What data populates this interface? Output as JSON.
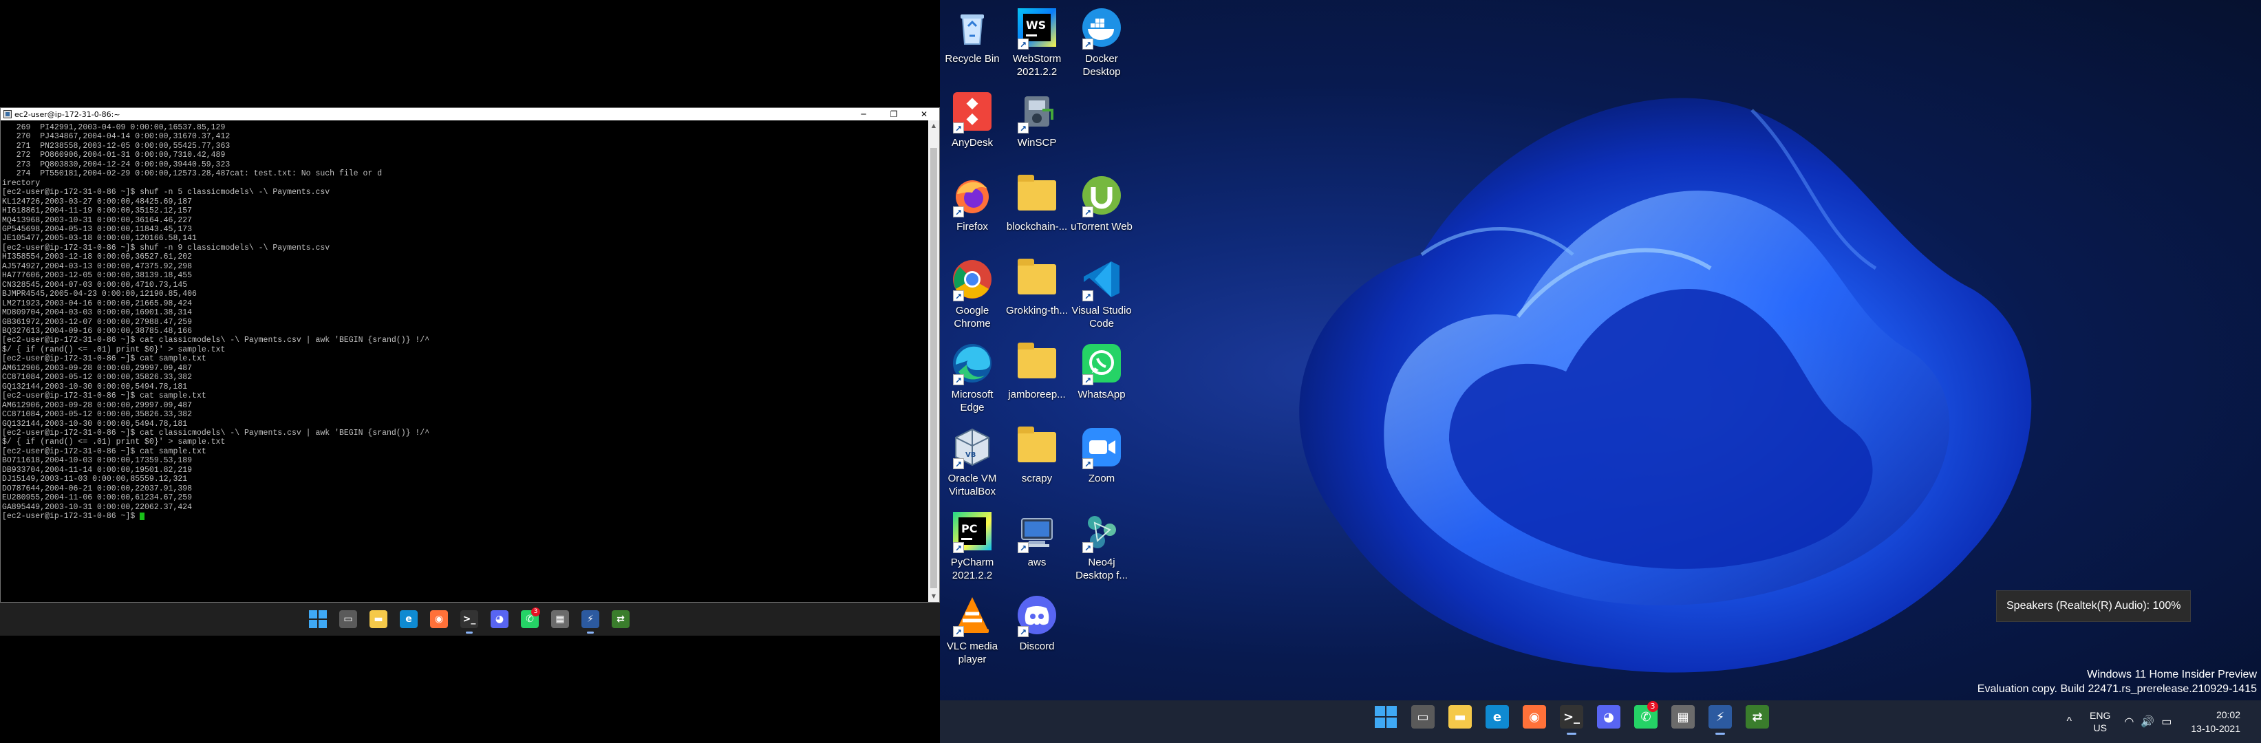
{
  "terminal": {
    "title": "ec2-user@ip-172-31-0-86:~",
    "controls": [
      "─",
      "❐",
      "✕"
    ],
    "lines": [
      "   269  PI42991,2003-04-09 0:00:00,16537.85,129",
      "   270  PJ434867,2004-04-14 0:00:00,31670.37,412",
      "   271  PN238558,2003-12-05 0:00:00,55425.77,363",
      "   272  PO860906,2004-01-31 0:00:00,7310.42,489",
      "   273  PQ803830,2004-12-24 0:00:00,39440.59,323",
      "   274  PT550181,2004-02-29 0:00:00,12573.28,487cat: test.txt: No such file or d",
      "irectory",
      "[ec2-user@ip-172-31-0-86 ~]$ shuf -n 5 classicmodels\\ -\\ Payments.csv",
      "KL124726,2003-03-27 0:00:00,48425.69,187",
      "HI618861,2004-11-19 0:00:00,35152.12,157",
      "MQ413968,2003-10-31 0:00:00,36164.46,227",
      "GP545698,2004-05-13 0:00:00,11843.45,173",
      "JE105477,2005-03-18 0:00:00,120166.58,141",
      "[ec2-user@ip-172-31-0-86 ~]$ shuf -n 9 classicmodels\\ -\\ Payments.csv",
      "HI358554,2003-12-18 0:00:00,36527.61,202",
      "AJ574927,2004-03-13 0:00:00,47375.92,298",
      "HA777606,2003-12-05 0:00:00,38139.18,455",
      "CN328545,2004-07-03 0:00:00,4710.73,145",
      "BJMPR4545,2005-04-23 0:00:00,12190.85,406",
      "LM271923,2003-04-16 0:00:00,21665.98,424",
      "MD809704,2004-03-03 0:00:00,16901.38,314",
      "GB361972,2003-12-07 0:00:00,27988.47,259",
      "BQ327613,2004-09-16 0:00:00,38785.48,166",
      "[ec2-user@ip-172-31-0-86 ~]$ cat classicmodels\\ -\\ Payments.csv | awk 'BEGIN {srand()} !/^",
      "$/ { if (rand() <= .01) print $0}' > sample.txt",
      "[ec2-user@ip-172-31-0-86 ~]$ cat sample.txt",
      "AM612906,2003-09-28 0:00:00,29997.09,487",
      "CC871084,2003-05-12 0:00:00,35826.33,382",
      "GQ132144,2003-10-30 0:00:00,5494.78,181",
      "[ec2-user@ip-172-31-0-86 ~]$ cat sample.txt",
      "AM612906,2003-09-28 0:00:00,29997.09,487",
      "CC871084,2003-05-12 0:00:00,35826.33,382",
      "GQ132144,2003-10-30 0:00:00,5494.78,181",
      "[ec2-user@ip-172-31-0-86 ~]$ cat classicmodels\\ -\\ Payments.csv | awk 'BEGIN {srand()} !/^",
      "$/ { if (rand() <= .01) print $0}' > sample.txt",
      "[ec2-user@ip-172-31-0-86 ~]$ cat sample.txt",
      "BO711618,2004-10-03 0:00:00,17359.53,189",
      "DB933704,2004-11-14 0:00:00,19501.82,219",
      "DJ15149,2003-11-03 0:00:00,85559.12,321",
      "DO787644,2004-06-21 0:00:00,22037.91,398",
      "EU280955,2004-11-06 0:00:00,61234.67,259",
      "GA895449,2003-10-31 0:00:00,22062.37,424"
    ],
    "prompt": "[ec2-user@ip-172-31-0-86 ~]$ "
  },
  "left_taskbar": {
    "icons": [
      {
        "name": "start-icon",
        "glyph": "",
        "color": "#3fa9f5",
        "active": false
      },
      {
        "name": "task-view-icon",
        "glyph": "▭",
        "color": "#5a5a5a",
        "active": false
      },
      {
        "name": "file-explorer-icon",
        "glyph": "▬",
        "color": "#f5c94a",
        "active": false
      },
      {
        "name": "edge-icon",
        "glyph": "e",
        "color": "#0f8ad1",
        "active": false
      },
      {
        "name": "firefox-icon",
        "glyph": "◉",
        "color": "#ff7139",
        "active": false
      },
      {
        "name": "terminal-icon",
        "glyph": ">_",
        "color": "#333333",
        "active": true
      },
      {
        "name": "discord-icon",
        "glyph": "◕",
        "color": "#5865f2",
        "active": false
      },
      {
        "name": "whatsapp-icon",
        "glyph": "✆",
        "color": "#25d366",
        "active": false,
        "badge": "3"
      },
      {
        "name": "calculator-icon",
        "glyph": "▦",
        "color": "#6b6b6b",
        "active": false
      },
      {
        "name": "putty-icon",
        "glyph": "⚡",
        "color": "#2c5aa0",
        "active": true
      },
      {
        "name": "winscp-icon",
        "glyph": "⇄",
        "color": "#3a7d2c",
        "active": false
      }
    ]
  },
  "desktop": {
    "icons": [
      {
        "name": "recycle-bin",
        "label": "Recycle Bin",
        "art": "recycle",
        "col": 0,
        "row": 0
      },
      {
        "name": "webstorm",
        "label": "WebStorm 2021.2.2",
        "art": "ws",
        "col": 1,
        "row": 0
      },
      {
        "name": "docker-desktop",
        "label": "Docker Desktop",
        "art": "docker",
        "col": 2,
        "row": 0
      },
      {
        "name": "anydesk",
        "label": "AnyDesk",
        "art": "anydesk",
        "col": 0,
        "row": 1
      },
      {
        "name": "winscp",
        "label": "WinSCP",
        "art": "winscp",
        "col": 1,
        "row": 1
      },
      {
        "name": "firefox",
        "label": "Firefox",
        "art": "firefox",
        "col": 0,
        "row": 2
      },
      {
        "name": "blockchain-folder",
        "label": "blockchain-...",
        "art": "folder",
        "col": 1,
        "row": 2
      },
      {
        "name": "utorrent-web",
        "label": "uTorrent Web",
        "art": "utorrent",
        "col": 2,
        "row": 2
      },
      {
        "name": "google-chrome",
        "label": "Google Chrome",
        "art": "chrome",
        "col": 0,
        "row": 3
      },
      {
        "name": "grokking-folder",
        "label": "Grokking-th...",
        "art": "folder",
        "col": 1,
        "row": 3
      },
      {
        "name": "visual-studio-code",
        "label": "Visual Studio Code",
        "art": "vscode",
        "col": 2,
        "row": 3
      },
      {
        "name": "microsoft-edge",
        "label": "Microsoft Edge",
        "art": "edge",
        "col": 0,
        "row": 4
      },
      {
        "name": "jamboree-folder",
        "label": "jamboreep...",
        "art": "folder",
        "col": 1,
        "row": 4
      },
      {
        "name": "whatsapp",
        "label": "WhatsApp",
        "art": "whatsapp",
        "col": 2,
        "row": 4
      },
      {
        "name": "oracle-vm-virtualbox",
        "label": "Oracle VM VirtualBox",
        "art": "vbox",
        "col": 0,
        "row": 5
      },
      {
        "name": "scrapy-folder",
        "label": "scrapy",
        "art": "folder",
        "col": 1,
        "row": 5
      },
      {
        "name": "zoom",
        "label": "Zoom",
        "art": "zoom",
        "col": 2,
        "row": 5
      },
      {
        "name": "pycharm",
        "label": "PyCharm 2021.2.2",
        "art": "pycharm",
        "col": 0,
        "row": 6
      },
      {
        "name": "aws",
        "label": "aws",
        "art": "aws",
        "col": 1,
        "row": 6
      },
      {
        "name": "neo4j-desktop",
        "label": "Neo4j Desktop f...",
        "art": "neo4j",
        "col": 2,
        "row": 6
      },
      {
        "name": "vlc-media-player",
        "label": "VLC media player",
        "art": "vlc",
        "col": 0,
        "row": 7
      },
      {
        "name": "discord",
        "label": "Discord",
        "art": "discord",
        "col": 1,
        "row": 7
      }
    ]
  },
  "tooltip": {
    "text": "Speakers (Realtek(R) Audio): 100%"
  },
  "watermark": {
    "line1": "Windows 11 Home Insider Preview",
    "line2": "Evaluation copy. Build 22471.rs_prerelease.210929-1415"
  },
  "right_taskbar": {
    "icons": [
      {
        "name": "start-icon",
        "glyph": "",
        "color": "#3fa9f5",
        "active": false
      },
      {
        "name": "task-view-icon",
        "glyph": "▭",
        "color": "#5a5a5a",
        "active": false
      },
      {
        "name": "file-explorer-icon",
        "glyph": "▬",
        "color": "#f5c94a",
        "active": false
      },
      {
        "name": "edge-icon",
        "glyph": "e",
        "color": "#0f8ad1",
        "active": false
      },
      {
        "name": "firefox-icon",
        "glyph": "◉",
        "color": "#ff7139",
        "active": false
      },
      {
        "name": "terminal-icon",
        "glyph": ">_",
        "color": "#333333",
        "active": true
      },
      {
        "name": "discord-icon",
        "glyph": "◕",
        "color": "#5865f2",
        "active": false
      },
      {
        "name": "whatsapp-icon",
        "glyph": "✆",
        "color": "#25d366",
        "active": false,
        "badge": "3"
      },
      {
        "name": "calculator-icon",
        "glyph": "▦",
        "color": "#6b6b6b",
        "active": false
      },
      {
        "name": "putty-icon",
        "glyph": "⚡",
        "color": "#2c5aa0",
        "active": true
      },
      {
        "name": "winscp-icon",
        "glyph": "⇄",
        "color": "#3a7d2c",
        "active": false
      }
    ],
    "tray": {
      "chevron": "^",
      "lang_top": "ENG",
      "lang_bottom": "US",
      "wifi": "◠",
      "volume": "🔊",
      "battery": "▭",
      "time": "20:02",
      "date": "13-10-2021"
    }
  }
}
